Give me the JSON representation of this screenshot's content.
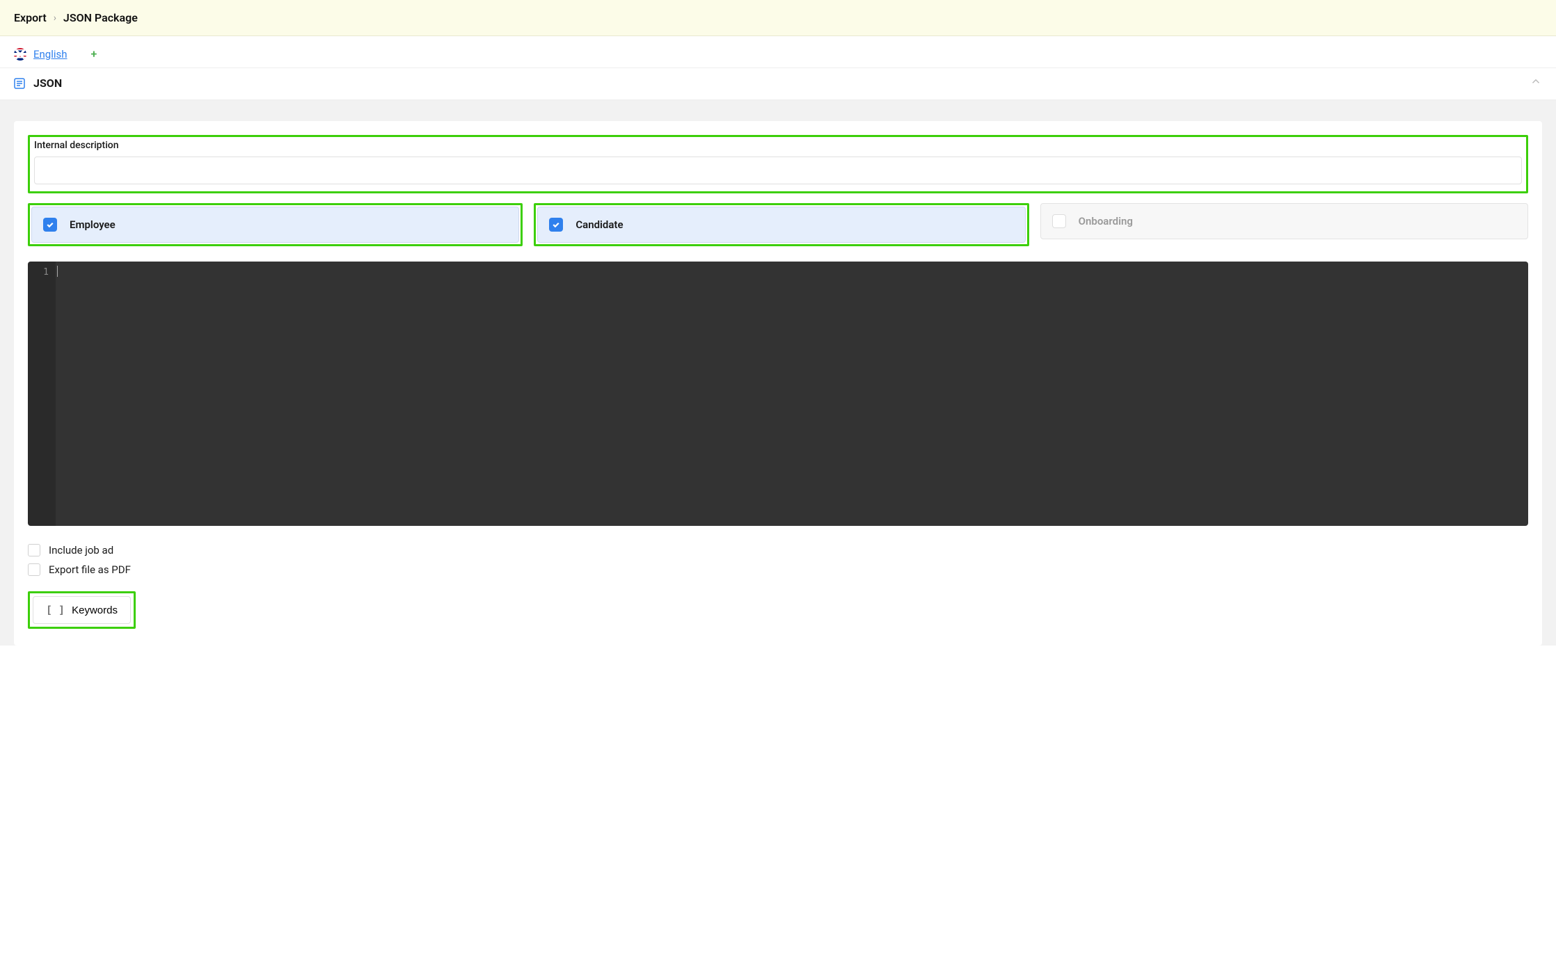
{
  "breadcrumb": {
    "root": "Export",
    "current": "JSON Package"
  },
  "language": {
    "name": "English"
  },
  "section": {
    "title": "JSON"
  },
  "form": {
    "description_label": "Internal description",
    "description_value": "",
    "cards": {
      "employee": {
        "label": "Employee",
        "checked": true
      },
      "candidate": {
        "label": "Candidate",
        "checked": true
      },
      "onboarding": {
        "label": "Onboarding",
        "checked": false
      }
    },
    "editor": {
      "first_line_number": "1",
      "content": ""
    },
    "options": {
      "include_job_ad": {
        "label": "Include job ad",
        "checked": false
      },
      "export_pdf": {
        "label": "Export file as PDF",
        "checked": false
      }
    },
    "keywords_button": "Keywords"
  }
}
